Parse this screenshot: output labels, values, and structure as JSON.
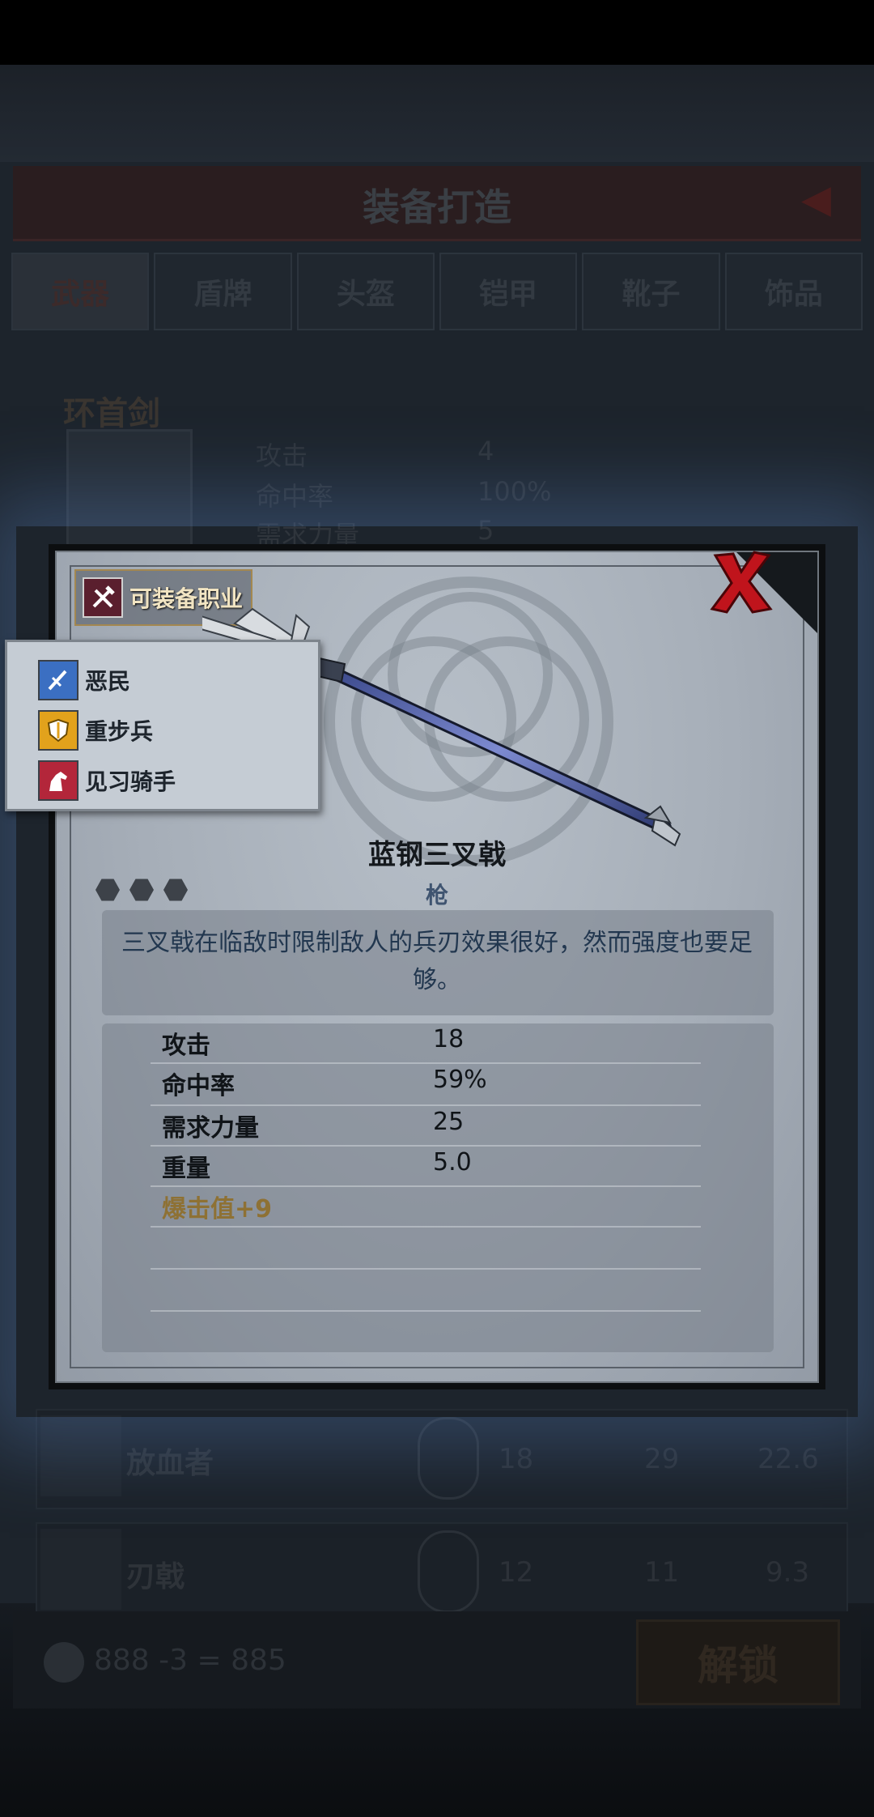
{
  "background": {
    "title": "装备打造",
    "tabs": [
      "武器",
      "盾牌",
      "头盔",
      "铠甲",
      "靴子",
      "饰品"
    ],
    "current_item": {
      "name": "环首剑",
      "stats": [
        {
          "label": "攻击",
          "value": "4"
        },
        {
          "label": "命中率",
          "value": "100%"
        },
        {
          "label": "需求力量",
          "value": "5"
        }
      ]
    },
    "list_rows": [
      {
        "name": "放血者",
        "nums": [
          "18",
          "29",
          "22.6"
        ]
      },
      {
        "name": "刃戟",
        "nums": [
          "12",
          "11",
          "9.3"
        ]
      }
    ],
    "currency_text": "888 -3 = 885",
    "unlock_label": "解锁"
  },
  "modal": {
    "job_button_label": "可装备职业",
    "item_name": "蓝钢三叉戟",
    "item_type": "枪",
    "rarity_hex_count": 3,
    "description": "三叉戟在临敌时限制敌人的兵刃效果很好，然而强度也要足够。",
    "stats": [
      {
        "label": "攻击",
        "value": "18"
      },
      {
        "label": "命中率",
        "value": "59%"
      },
      {
        "label": "需求力量",
        "value": "25"
      },
      {
        "label": "重量",
        "value": "5.0"
      }
    ],
    "bonus": "爆击值+9",
    "close_icon": "close-icon"
  },
  "class_popup": {
    "classes": [
      {
        "name": "恶民",
        "icon": "sword-icon",
        "color": "#3b6fc2"
      },
      {
        "name": "重步兵",
        "icon": "shield-icon",
        "color": "#e2a21c"
      },
      {
        "name": "见习骑手",
        "icon": "horse-icon",
        "color": "#b3263a"
      }
    ]
  }
}
